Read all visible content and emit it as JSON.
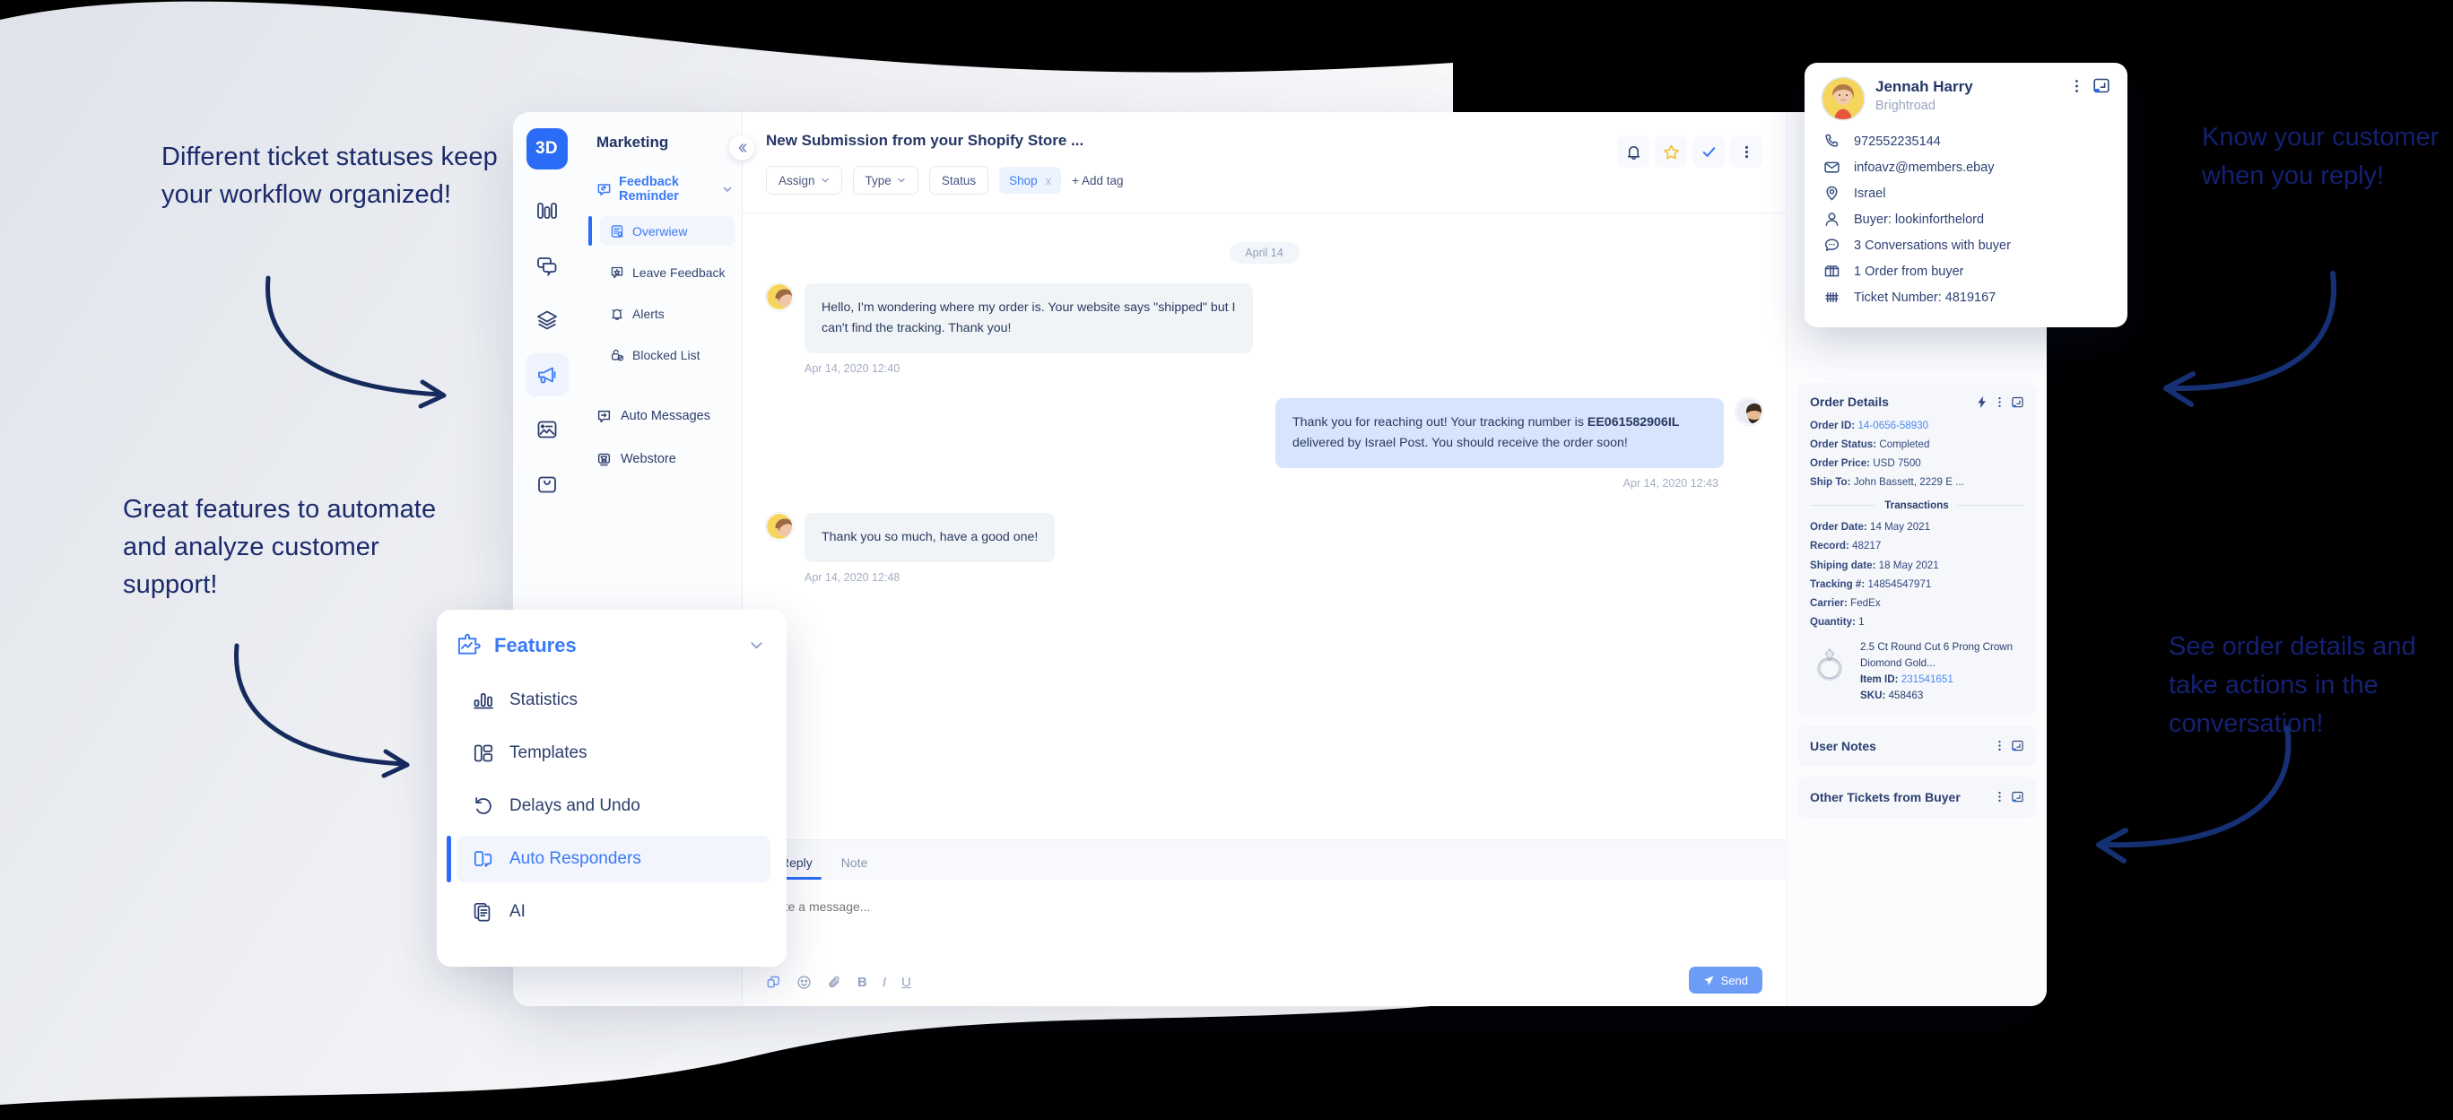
{
  "annotations": {
    "left_top": "Different ticket statuses keep your workflow organized!",
    "left_bottom": "Great features to automate and analyze customer support!",
    "right_top": "Know your customer when you reply!",
    "right_bottom": "See order details and take actions in the conversation!"
  },
  "app": {
    "logo": "3D",
    "nav": {
      "title": "Marketing",
      "group": {
        "label": "Feedback Reminder",
        "icon": "feedback-reminder-icon"
      },
      "items": [
        {
          "label": "Overwiew",
          "icon": "overview-icon",
          "active": true
        },
        {
          "label": "Leave Feedback",
          "icon": "leave-feedback-icon",
          "active": false
        },
        {
          "label": "Alerts",
          "icon": "alerts-bell-icon",
          "active": false
        },
        {
          "label": "Blocked List",
          "icon": "blocked-list-icon",
          "active": false
        }
      ],
      "roots": [
        {
          "label": "Auto Messages",
          "icon": "auto-messages-icon"
        },
        {
          "label": "Webstore",
          "icon": "webstore-cart-icon"
        }
      ]
    },
    "rail": [
      {
        "icon": "statistics-bars-icon",
        "active": false
      },
      {
        "icon": "conversations-icon",
        "active": false
      },
      {
        "icon": "layers-icon",
        "active": false
      },
      {
        "icon": "megaphone-icon",
        "active": true
      },
      {
        "icon": "image-card-icon",
        "active": false
      },
      {
        "icon": "shopping-bag-icon",
        "active": false
      }
    ],
    "conversation": {
      "title": "New Submission from your Shopify Store ...",
      "filters": [
        {
          "label": "Assign",
          "caret": true
        },
        {
          "label": "Type",
          "caret": true
        },
        {
          "label": "Status",
          "caret": false
        }
      ],
      "tag": {
        "label": "Shop",
        "remove": "x"
      },
      "add_tag": "+ Add tag",
      "actions": [
        "bell-icon",
        "star-icon",
        "check-icon",
        "more-vertical-icon"
      ],
      "date_divider": "April 14",
      "messages": [
        {
          "direction": "in",
          "text": "Hello, I'm wondering where my order is. Your website says \"shipped\" but I can't find the tracking. Thank you!",
          "timestamp": "Apr 14, 2020 12:40"
        },
        {
          "direction": "out",
          "text_before": "Thank you for reaching out! Your tracking number is ",
          "tracking": "EE061582906IL",
          "text_after": " delivered by Israel Post. You should receive the order soon!",
          "timestamp": "Apr 14, 2020 12:43"
        },
        {
          "direction": "in",
          "text": "Thank you so much, have a good one!",
          "timestamp": "Apr 14, 2020 12:48"
        }
      ],
      "composer": {
        "tabs": [
          {
            "label": "Reply",
            "active": true
          },
          {
            "label": "Note",
            "active": false
          }
        ],
        "placeholder": "Write a message...",
        "toolbar": [
          "canned-response-icon",
          "emoji-icon",
          "attachment-icon",
          "bold-icon",
          "italic-icon",
          "underline-icon"
        ],
        "send_label": "Send"
      }
    },
    "details": {
      "order": {
        "title": "Order Details",
        "head_icons": [
          "lightning-icon",
          "more-vertical-icon",
          "expand-icon"
        ],
        "fields": [
          {
            "label": "Order ID:",
            "value": "14-0656-58930",
            "link": true
          },
          {
            "label": "Order Status:",
            "value": "Completed",
            "link": false
          },
          {
            "label": "Order Price:",
            "value": "USD 7500",
            "link": false
          },
          {
            "label": "Ship To:",
            "value": "John Bassett, 2229 E ...",
            "link": false
          }
        ],
        "divider": "Transactions",
        "transactions": [
          {
            "label": "Order Date:",
            "value": "14 May 2021"
          },
          {
            "label": "Record:",
            "value": "48217"
          },
          {
            "label": "Shiping date:",
            "value": "18 May 2021"
          },
          {
            "label": "Tracking #:",
            "value": "14854547971"
          },
          {
            "label": "Carrier:",
            "value": "FedEx"
          },
          {
            "label": "Quantity:",
            "value": "1"
          }
        ],
        "product": {
          "name": "2.5 Ct Round Cut 6 Prong Crown Diomond Gold...",
          "item_id_label": "Item ID:",
          "item_id": "231541651",
          "sku_label": "SKU:",
          "sku": "458463"
        }
      },
      "user_notes": {
        "title": "User Notes",
        "head_icons": [
          "more-vertical-icon",
          "expand-icon"
        ]
      },
      "other_tickets": {
        "title": "Other Tickets from Buyer",
        "head_icons": [
          "more-vertical-icon",
          "expand-icon"
        ]
      }
    }
  },
  "customer_card": {
    "name": "Jennah Harry",
    "company": "Brightroad",
    "head_icons": [
      "more-vertical-icon",
      "expand-icon"
    ],
    "rows": [
      {
        "icon": "phone-icon",
        "text": "972552235144"
      },
      {
        "icon": "mail-icon",
        "text": "infoavz@members.ebay"
      },
      {
        "icon": "location-pin-icon",
        "text": "Israel"
      },
      {
        "icon": "user-icon",
        "text": "Buyer: lookinforthelord"
      },
      {
        "icon": "chat-bubble-icon",
        "text": "3 Conversations with buyer"
      },
      {
        "icon": "package-icon",
        "text": "1 Order from buyer"
      },
      {
        "icon": "tally-icon",
        "text": "Ticket Number: 4819167"
      }
    ]
  },
  "features_card": {
    "title": "Features",
    "icon": "features-puzzle-icon",
    "chevron": "chevron-down-icon",
    "items": [
      {
        "label": "Statistics",
        "icon": "statistics-bars-icon",
        "active": false
      },
      {
        "label": "Templates",
        "icon": "templates-icon",
        "active": false
      },
      {
        "label": "Delays and Undo",
        "icon": "delays-undo-icon",
        "active": false
      },
      {
        "label": "Auto Responders",
        "icon": "auto-responders-icon",
        "active": true
      },
      {
        "label": "AI",
        "icon": "ai-docs-icon",
        "active": false
      }
    ]
  },
  "colors": {
    "brand_blue": "#2b6cf6",
    "accent_link": "#4b87f5",
    "navy_text": "#24376a",
    "star_yellow": "#f5c13b",
    "bubble_in": "#f1f4f7",
    "bubble_out": "#d7e4fd"
  }
}
